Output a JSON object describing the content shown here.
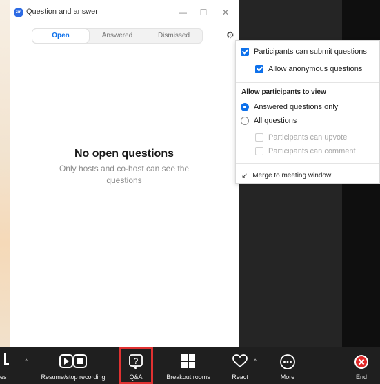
{
  "window": {
    "logo_text": "zm",
    "title": "Question and answer",
    "controls": {
      "minimize": "—",
      "maximize": "☐",
      "close": "✕"
    }
  },
  "tabs": [
    {
      "label": "Open",
      "active": true
    },
    {
      "label": "Answered",
      "active": false
    },
    {
      "label": "Dismissed",
      "active": false
    }
  ],
  "settings_icon": "gear-icon",
  "empty_state": {
    "title": "No open questions",
    "subtitle": "Only hosts and co-host can see the questions"
  },
  "settings_menu": {
    "submit_questions": {
      "label": "Participants can submit questions",
      "checked": true
    },
    "anonymous": {
      "label": "Allow anonymous questions",
      "checked": true
    },
    "view_heading": "Allow participants to view",
    "answered_only": {
      "label": "Answered questions only",
      "selected": true
    },
    "all_questions": {
      "label": "All questions",
      "selected": false
    },
    "upvote": {
      "label": "Participants can upvote",
      "checked": false,
      "disabled": true
    },
    "comment": {
      "label": "Participants can comment",
      "checked": false,
      "disabled": true
    },
    "merge": "Merge to meeting window"
  },
  "toolbar": {
    "partial_label": "es",
    "record_label": "Resume/stop recording",
    "qa_label": "Q&A",
    "breakout_label": "Breakout rooms",
    "react_label": "React",
    "more_label": "More",
    "end_label": "End"
  },
  "colors": {
    "accent": "#0e71eb",
    "highlight": "#e03131",
    "end_button": "#e02828",
    "toolbar_bg": "#1f1f1f"
  }
}
